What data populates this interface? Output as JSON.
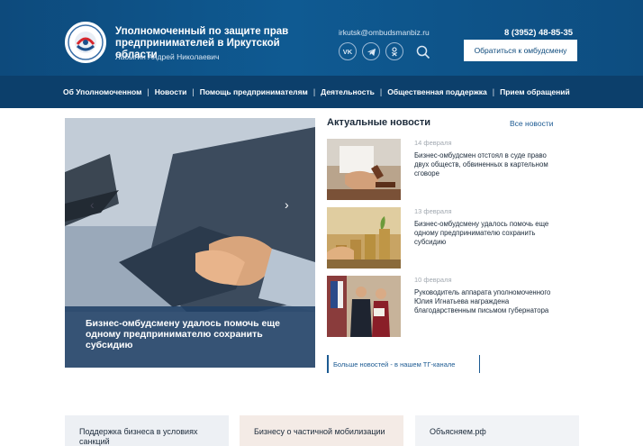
{
  "header": {
    "title": "Уполномоченный по защите прав предпринимателей в Иркутской области",
    "person": "Лабыгин Андрей Николаевич",
    "email": "irkutsk@ombudsmanbiz.ru",
    "phone": "8 (3952) 48-85-35",
    "cta_label": "Обратиться к омбудсмену",
    "socials": [
      {
        "icon": "vk-icon",
        "label": "VK"
      },
      {
        "icon": "telegram-icon",
        "label": ""
      },
      {
        "icon": "odnoklassniki-icon",
        "label": ""
      }
    ]
  },
  "nav": {
    "items": [
      "Об Уполномоченном",
      "Новости",
      "Помощь предпринимателям",
      "Деятельность",
      "Общественная поддержка",
      "Прием обращений"
    ]
  },
  "slider": {
    "caption": "Бизнес-омбудсмену удалось помочь еще одному предпринимателю сохранить субсидию"
  },
  "news": {
    "heading": "Актуальные новости",
    "all_link": "Все новости",
    "items": [
      {
        "date": "14 февраля",
        "text": "Бизнес-омбудсмен отстоял в суде право двух обществ, обвиненных в картельном сговоре"
      },
      {
        "date": "13 февраля",
        "text": "Бизнес-омбудсмену удалось помочь еще одному предпринимателю сохранить субсидию"
      },
      {
        "date": "10 февраля",
        "text": "Руководитель аппарата уполномоченного Юлия Игнатьева награждена благодарственным письмом губернатора"
      }
    ],
    "more_link": "Больше новостей - в нашем ТГ-канале"
  },
  "cards": [
    "Поддержка бизнеса в условиях санкций",
    "Бизнесу о частичной мобилизации",
    "Объясняем.рф"
  ],
  "colors": {
    "header_bg": "#0f5a92",
    "nav_bg": "#0c3f6b",
    "accent": "#1c5a92"
  }
}
